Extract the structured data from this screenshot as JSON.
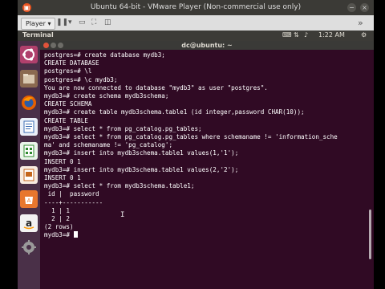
{
  "vm": {
    "window_title": "Ubuntu 64-bit - VMware Player (Non-commercial use only)",
    "player_menu": "Player",
    "minimize_glyph": "−",
    "close_glyph": "×"
  },
  "panel": {
    "app_name": "Terminal",
    "time": "1:22 AM",
    "keyboard": "En",
    "icons": [
      "keyboard-icon",
      "network-icon",
      "volume-icon",
      "gear-icon"
    ]
  },
  "terminal": {
    "title": "dc@ubuntu: ~",
    "lines": [
      "postgres=# create database mydb3;",
      "CREATE DATABASE",
      "postgres=# \\l",
      "postgres=# \\c mydb3;",
      "You are now connected to database \"mydb3\" as user \"postgres\".",
      "mydb3=# create schema mydb3schema;",
      "CREATE SCHEMA",
      "mydb3=# create table mydb3schema.table1 (id integer,password CHAR(10));",
      "CREATE TABLE",
      "mydb3=# select * from pg_catalog.pg_tables;",
      "mydb3=# select * from pg_catalog.pg_tables where schemaname != 'information_sche",
      "ma' and schemaname != 'pg_catalog';",
      "mydb3=# insert into mydb3schema.table1 values(1,'1');",
      "INSERT 0 1",
      "mydb3=# insert into mydb3schema.table1 values(2,'2');",
      "INSERT 0 1",
      "mydb3=# select * from mydb3schema.table1;",
      " id |  password",
      "----+-----------",
      "  1 | 1",
      "  2 | 2",
      "(2 rows)",
      "",
      "mydb3=# "
    ]
  },
  "colors": {
    "terminal_bg": "#300a24",
    "launcher_bg": "#4a3048",
    "accent": "#e95420"
  },
  "launcher": [
    "ubuntu-dash-icon",
    "files-icon",
    "firefox-icon",
    "writer-icon",
    "calc-icon",
    "impress-icon",
    "software-center-icon",
    "amazon-icon",
    "settings-icon"
  ]
}
